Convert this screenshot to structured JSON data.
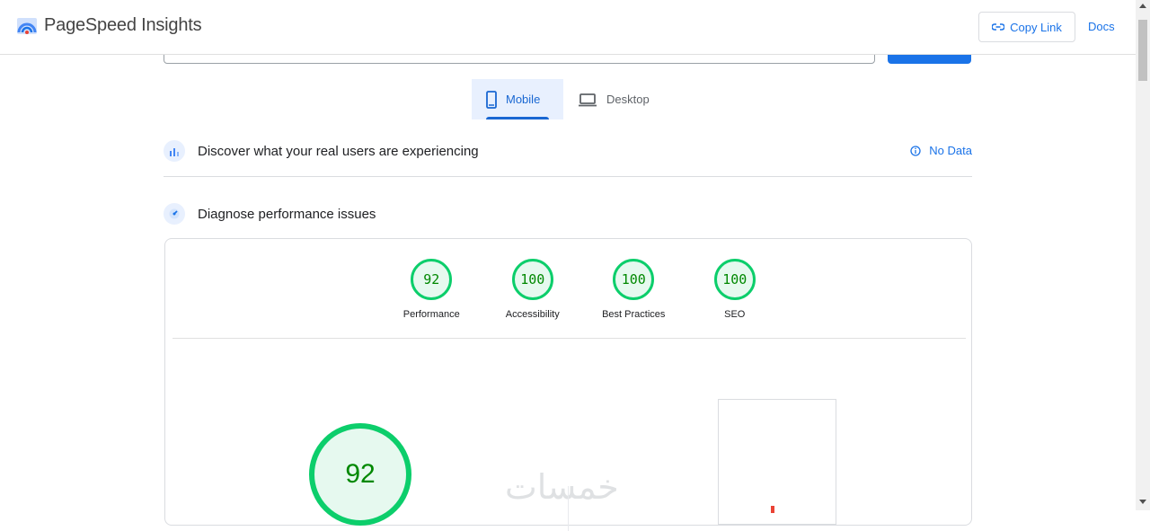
{
  "header": {
    "app_title": "PageSpeed Insights",
    "copy_link": "Copy Link",
    "docs": "Docs"
  },
  "tabs": [
    {
      "label": "Mobile",
      "active": true,
      "icon": "phone-icon"
    },
    {
      "label": "Desktop",
      "active": false,
      "icon": "laptop-icon"
    }
  ],
  "real_users": {
    "title": "Discover what your real users are experiencing",
    "status": "No Data"
  },
  "diagnose": {
    "title": "Diagnose performance issues"
  },
  "scores": [
    {
      "label": "Performance",
      "value": "92"
    },
    {
      "label": "Accessibility",
      "value": "100"
    },
    {
      "label": "Best Practices",
      "value": "100"
    },
    {
      "label": "SEO",
      "value": "100"
    }
  ],
  "performance_main": {
    "value": "92"
  },
  "watermark": "خمسات",
  "colors": {
    "accent": "#1a73e8",
    "pass": "#0cce6b",
    "pass_text": "#008800"
  }
}
